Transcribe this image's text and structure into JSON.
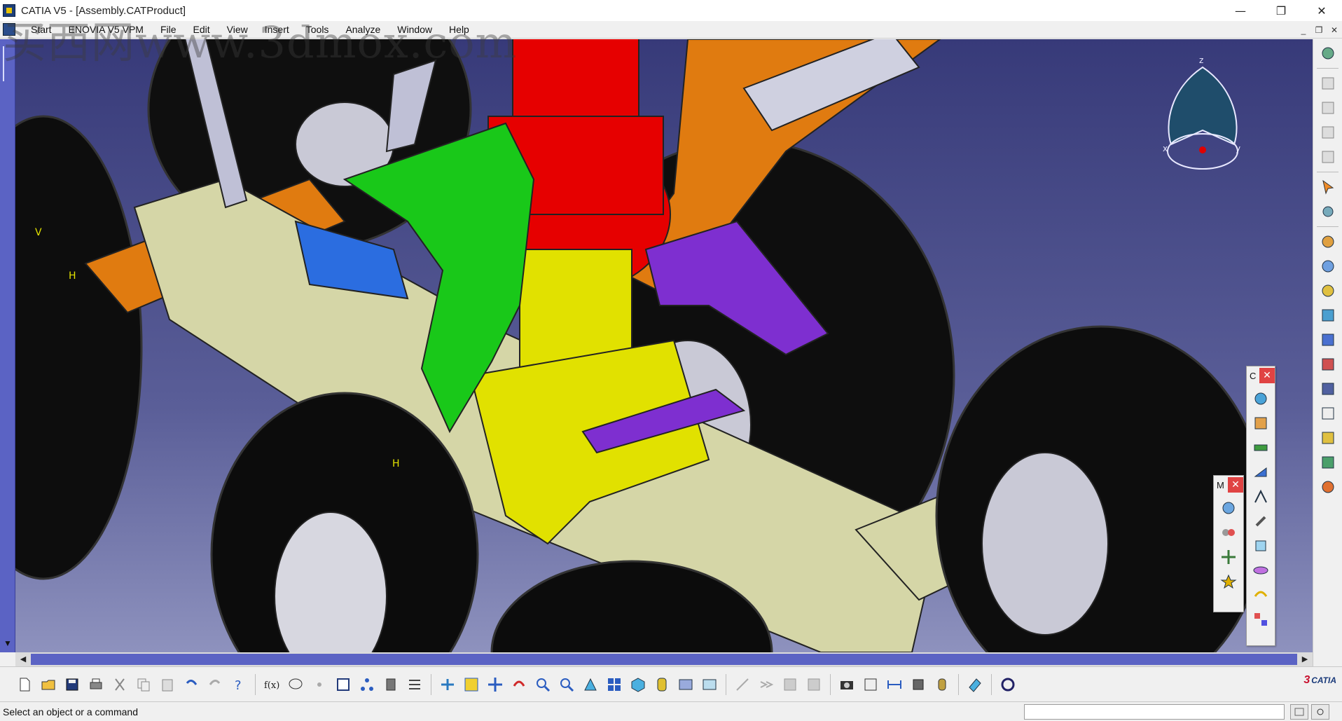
{
  "window": {
    "title": "CATIA V5 - [Assembly.CATProduct]",
    "controls": {
      "minimize": "—",
      "maximize": "❐",
      "close": "✕"
    }
  },
  "menu": {
    "items": [
      "Start",
      "ENOVIA V5 VPM",
      "File",
      "Edit",
      "View",
      "Insert",
      "Tools",
      "Analyze",
      "Window",
      "Help"
    ],
    "doc_controls": {
      "minimize": "_",
      "restore": "❐",
      "close": "✕"
    }
  },
  "watermark": "买西网www.3dmox.com",
  "compass": {
    "z_label": "z",
    "x_label": "x",
    "y_label": "y"
  },
  "model_labels": {
    "v": "V",
    "h": "H"
  },
  "floating_toolbar_1": {
    "title": "C",
    "close": "✕"
  },
  "floating_toolbar_2": {
    "title": "M",
    "close": "✕"
  },
  "scroll": {
    "left": "◀",
    "right": "▶",
    "down": "▼"
  },
  "bottom_logo": "CATIA",
  "status": {
    "text": "Select an object or a command"
  },
  "colors": {
    "background_top": "#373a79",
    "red_part": "#e60000",
    "green_part": "#19c819",
    "yellow_part": "#e1e100",
    "purple_part": "#7e2fd0",
    "orange_part": "#e07b10",
    "beige_part": "#d5d6a7",
    "blue_part": "#2b6de0",
    "tire": "#0d0d0d"
  },
  "icons": {
    "toolbar_bottom": [
      "new-icon",
      "open-icon",
      "save-icon",
      "print-icon",
      "cut-icon",
      "copy-icon",
      "paste-icon",
      "undo-icon",
      "redo-icon",
      "whats-this-icon",
      "formula-icon",
      "knowledge-icon",
      "link-icon",
      "table-icon",
      "tree-icon",
      "catalog-icon",
      "measure-icon",
      "fly-mode-icon",
      "fit-all-icon",
      "pan-icon",
      "rotate-icon",
      "zoom-in-icon",
      "zoom-out-icon",
      "normal-view-icon",
      "multi-view-icon",
      "iso-view-icon",
      "render-style-icon",
      "hide-show-icon",
      "swap-space-icon",
      "camera-icon",
      "publish-icon",
      "measure-between-icon",
      "clash-icon",
      "inertia-icon",
      "sketch-icon",
      "sync-icon"
    ],
    "toolbar_right": [
      "product-settings-icon",
      "generic-tree-1-icon",
      "generic-tree-2-icon",
      "generic-tree-3-icon",
      "generic-tree-4-icon",
      "select-icon",
      "move-icon",
      "assembly-1-icon",
      "assembly-2-icon",
      "assembly-3-icon",
      "assembly-4-icon",
      "assembly-5-icon",
      "assembly-6-icon",
      "assembly-7-icon",
      "assembly-8-icon",
      "assembly-9-icon",
      "assembly-10-icon",
      "assembly-11-icon"
    ]
  }
}
